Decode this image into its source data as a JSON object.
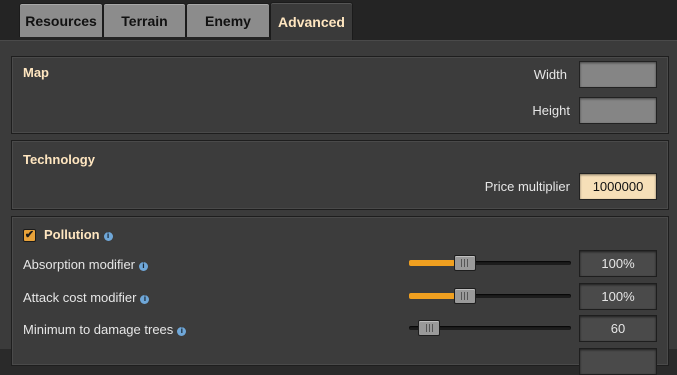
{
  "tabs": [
    {
      "label": "Resources",
      "active": false
    },
    {
      "label": "Terrain",
      "active": false
    },
    {
      "label": "Enemy",
      "active": false
    },
    {
      "label": "Advanced",
      "active": true
    }
  ],
  "map": {
    "title": "Map",
    "width_label": "Width",
    "width_value": "",
    "height_label": "Height",
    "height_value": ""
  },
  "technology": {
    "title": "Technology",
    "price_multiplier_label": "Price multiplier",
    "price_multiplier_value": "1000000"
  },
  "pollution": {
    "title": "Pollution",
    "enabled": true,
    "check_glyph": "✔",
    "info_glyph": "i",
    "rows": [
      {
        "label": "Absorption modifier",
        "value": "100%",
        "level": 0.25
      },
      {
        "label": "Attack cost modifier",
        "value": "100%",
        "level": 0.25
      },
      {
        "label": "Minimum to damage trees",
        "value": "60",
        "level": 0.0
      }
    ]
  },
  "colors": {
    "accent": "#f0a020",
    "title": "#ffe6c0",
    "info": "#6fa7d8"
  }
}
